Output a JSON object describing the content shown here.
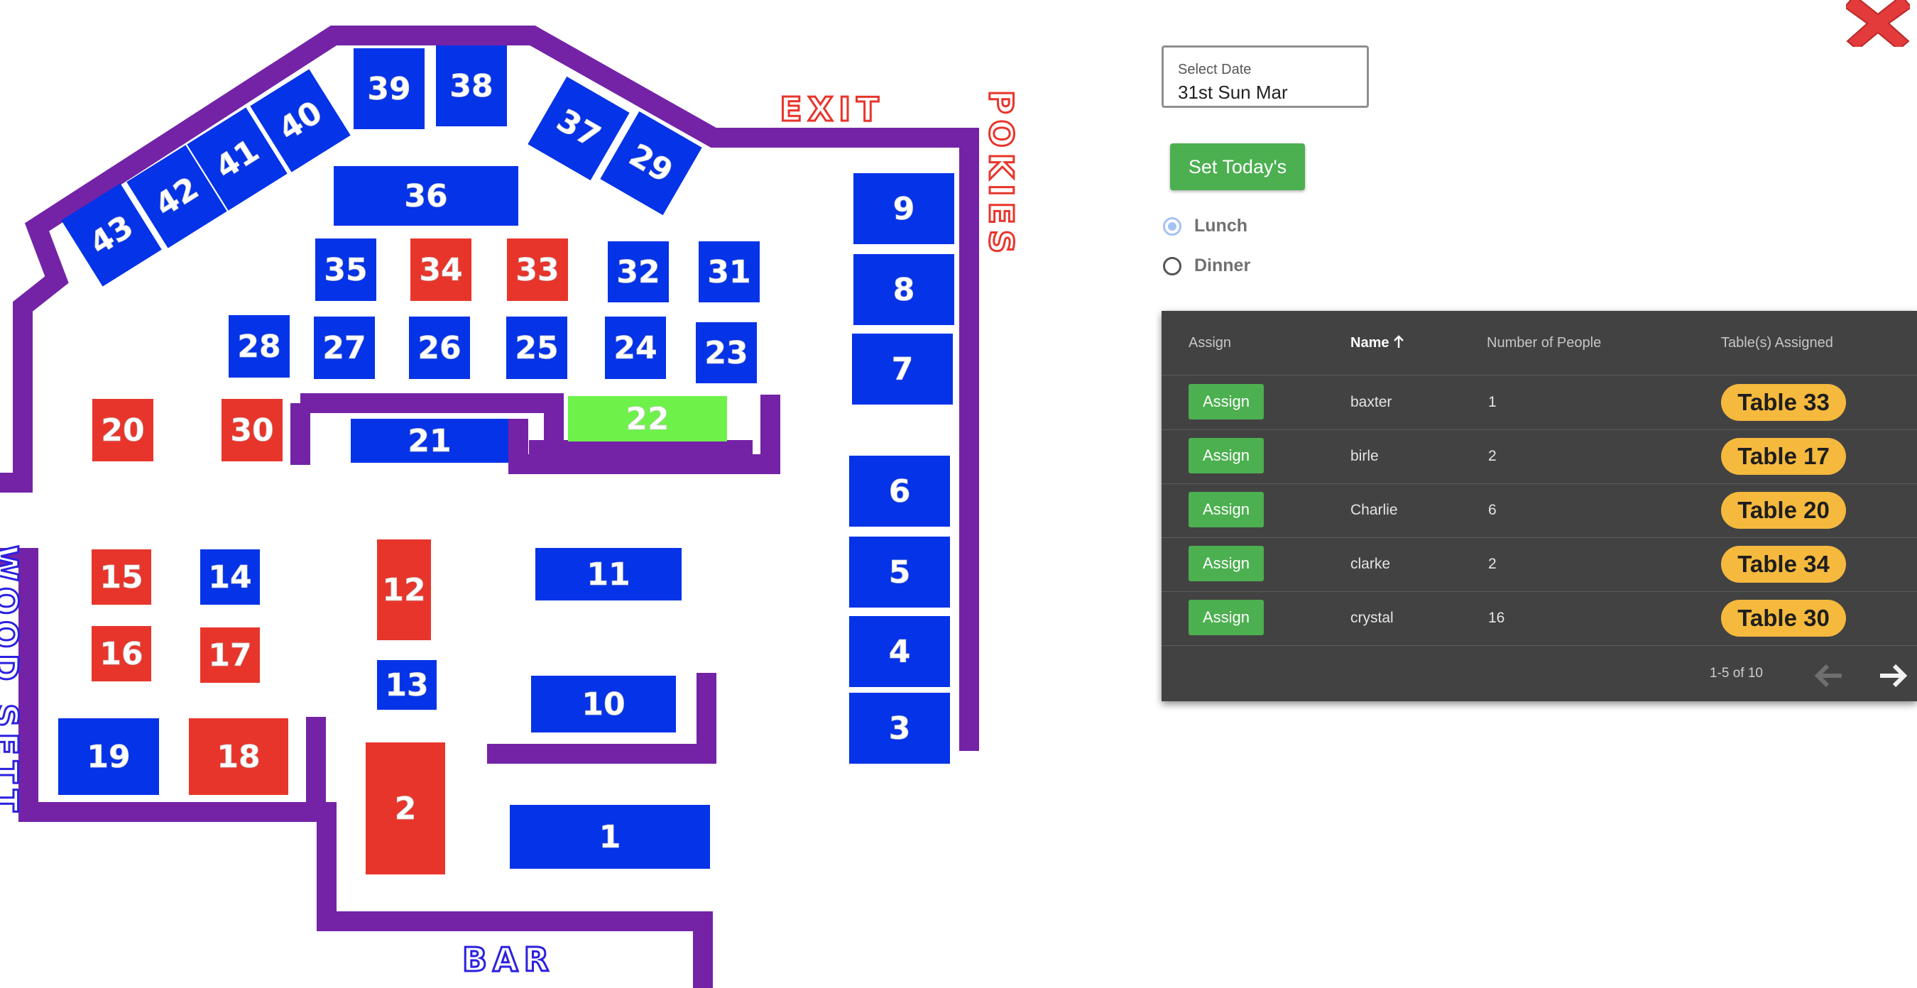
{
  "floor_plan": {
    "tables": [
      {
        "id": "1",
        "status": "free"
      },
      {
        "id": "2",
        "status": "taken"
      },
      {
        "id": "3",
        "status": "free"
      },
      {
        "id": "4",
        "status": "free"
      },
      {
        "id": "5",
        "status": "free"
      },
      {
        "id": "6",
        "status": "free"
      },
      {
        "id": "7",
        "status": "free"
      },
      {
        "id": "8",
        "status": "free"
      },
      {
        "id": "9",
        "status": "free"
      },
      {
        "id": "10",
        "status": "free"
      },
      {
        "id": "11",
        "status": "free"
      },
      {
        "id": "12",
        "status": "taken"
      },
      {
        "id": "13",
        "status": "free"
      },
      {
        "id": "14",
        "status": "free"
      },
      {
        "id": "15",
        "status": "taken"
      },
      {
        "id": "16",
        "status": "taken"
      },
      {
        "id": "17",
        "status": "taken"
      },
      {
        "id": "18",
        "status": "taken"
      },
      {
        "id": "19",
        "status": "free"
      },
      {
        "id": "20",
        "status": "taken"
      },
      {
        "id": "21",
        "status": "free"
      },
      {
        "id": "22",
        "status": "selected"
      },
      {
        "id": "23",
        "status": "free"
      },
      {
        "id": "24",
        "status": "free"
      },
      {
        "id": "25",
        "status": "free"
      },
      {
        "id": "26",
        "status": "free"
      },
      {
        "id": "27",
        "status": "free"
      },
      {
        "id": "28",
        "status": "free"
      },
      {
        "id": "29",
        "status": "free"
      },
      {
        "id": "30",
        "status": "taken"
      },
      {
        "id": "31",
        "status": "free"
      },
      {
        "id": "32",
        "status": "free"
      },
      {
        "id": "33",
        "status": "taken"
      },
      {
        "id": "34",
        "status": "taken"
      },
      {
        "id": "35",
        "status": "free"
      },
      {
        "id": "36",
        "status": "free"
      },
      {
        "id": "37",
        "status": "free"
      },
      {
        "id": "38",
        "status": "free"
      },
      {
        "id": "39",
        "status": "free"
      },
      {
        "id": "40",
        "status": "free"
      },
      {
        "id": "41",
        "status": "free"
      },
      {
        "id": "42",
        "status": "free"
      },
      {
        "id": "43",
        "status": "free"
      }
    ],
    "areas": {
      "exit": "EXIT",
      "pokies": "POKIES",
      "bar": "BAR",
      "side": "WOOD SETT"
    },
    "colors": {
      "free": "#0433e8",
      "taken": "#e8352b",
      "selected": "#6ef24a",
      "wall": "#7423a6"
    }
  },
  "booking": {
    "date_label": "Select Date",
    "date_value": "31st Sun Mar",
    "set_today_label": "Set Today's",
    "services": [
      {
        "label": "Lunch",
        "selected": true
      },
      {
        "label": "Dinner",
        "selected": false
      }
    ]
  },
  "table": {
    "headers": {
      "assign": "Assign",
      "name": "Name",
      "people": "Number of People",
      "tables": "Table(s) Assigned"
    },
    "sort_icon": "arrow-up-icon",
    "rows": [
      {
        "action": "Assign",
        "name": "baxter",
        "people": "1",
        "table": "Table 33"
      },
      {
        "action": "Assign",
        "name": "birle",
        "people": "2",
        "table": "Table 17"
      },
      {
        "action": "Assign",
        "name": "Charlie",
        "people": "6",
        "table": "Table 20"
      },
      {
        "action": "Assign",
        "name": "clarke",
        "people": "2",
        "table": "Table 34"
      },
      {
        "action": "Assign",
        "name": "crystal",
        "people": "16",
        "table": "Table 30"
      }
    ],
    "range": "1-5 of 10",
    "prev_icon": "arrow-left-icon",
    "next_icon": "arrow-right-icon"
  }
}
